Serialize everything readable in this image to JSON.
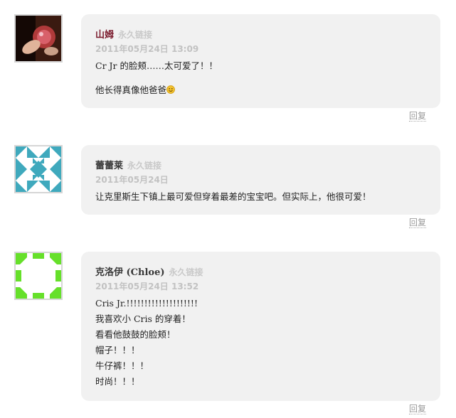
{
  "comments": [
    {
      "author": "山姆",
      "permalink": "永久链接",
      "date": "2011年05月24日 13:09",
      "lines": [
        "Cr Jr 的脸颊……太可爱了！！",
        "他长得真像他爸爸"
      ],
      "smile_icon": "smile-emoji-icon",
      "reply": "回复",
      "author_color": "#7a1a2c"
    },
    {
      "author": "蕾蕾莱",
      "permalink": "永久链接",
      "date": "2011年05月24日",
      "lines": [
        "让克里斯生下镇上最可爱但穿着最差的宝宝吧。但实际上，他很可爱！"
      ],
      "reply": "回复"
    },
    {
      "author": "克洛伊 (Chloe)",
      "permalink": "永久链接",
      "date": "2011年05月24日 13:52",
      "lines": [
        "Cris Jr.!!!!!!!!!!!!!!!!!!!!",
        "我喜欢小 Cris 的穿着！",
        "看看他鼓鼓的脸颊！",
        "帽子！！！",
        "牛仔裤！！！",
        "时尚！！！"
      ],
      "reply": "回复"
    }
  ]
}
